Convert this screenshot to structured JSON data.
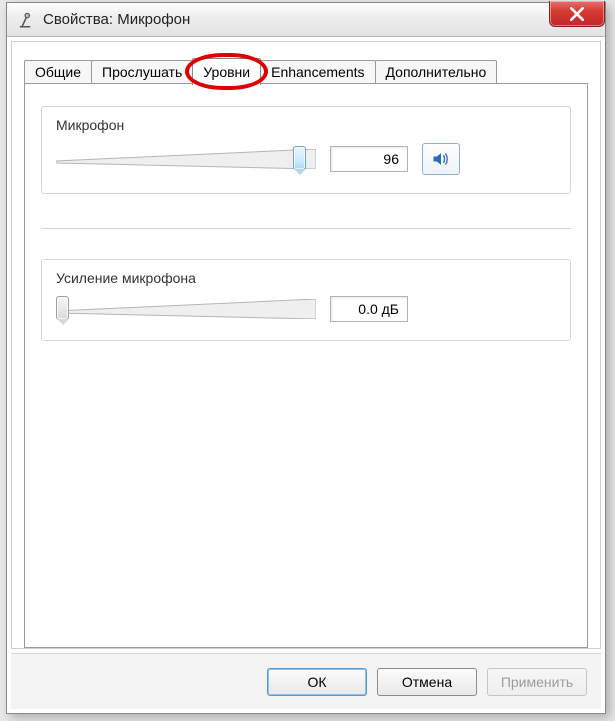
{
  "window": {
    "title": "Свойства: Микрофон"
  },
  "tabs": [
    {
      "label": "Общие"
    },
    {
      "label": "Прослушать"
    },
    {
      "label": "Уровни"
    },
    {
      "label": "Enhancements"
    },
    {
      "label": "Дополнительно"
    }
  ],
  "active_tab_index": 2,
  "highlighted_tab_index": 2,
  "levels": {
    "microphone": {
      "label": "Микрофон",
      "value": "96",
      "slider_pct": 96
    },
    "boost": {
      "label": "Усиление микрофона",
      "value": "0.0 дБ",
      "slider_pct": 0
    }
  },
  "footer": {
    "ok": "ОК",
    "cancel": "Отмена",
    "apply": "Применить"
  },
  "icons": {
    "app": "mic-stand-icon",
    "close": "close-icon",
    "speaker": "speaker-icon"
  }
}
